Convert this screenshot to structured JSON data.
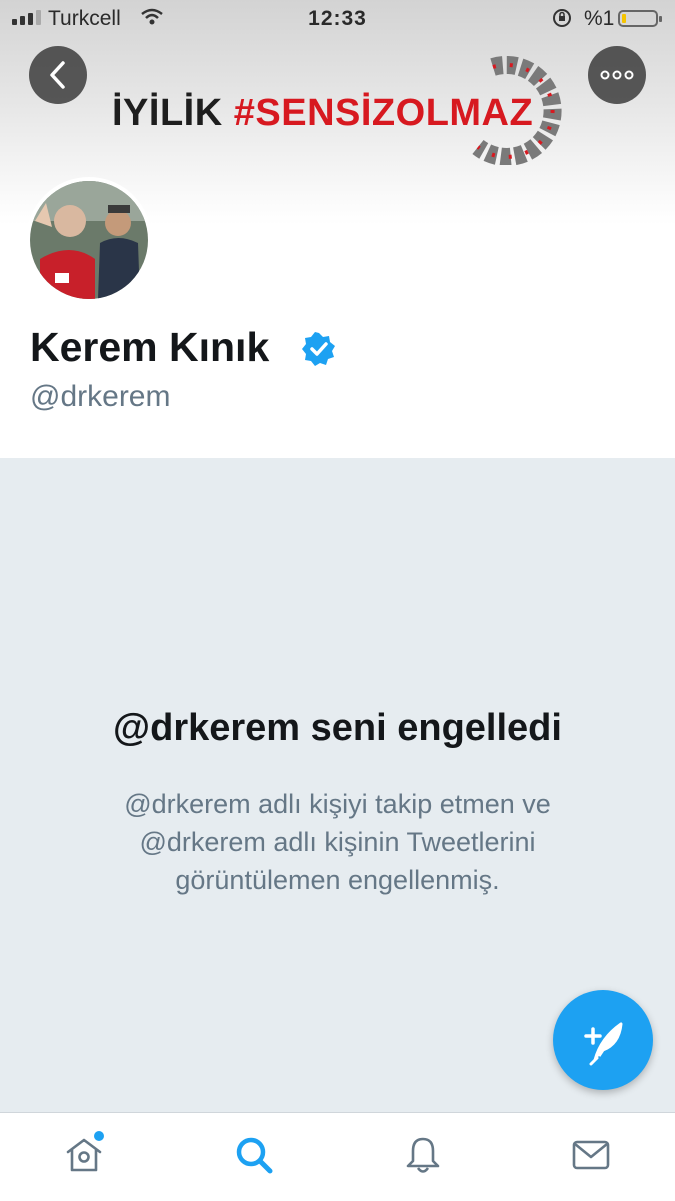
{
  "status_bar": {
    "carrier": "Turkcell",
    "time": "12:33",
    "battery_percent": "%1",
    "battery_level": 0.01
  },
  "header": {
    "banner_text_part1": "İYİLİK",
    "banner_text_part2": "#SENSİZOLMAZ",
    "back_icon": "chevron-left-icon",
    "more_icon": "more-horizontal-icon"
  },
  "profile": {
    "display_name": "Kerem Kınık",
    "handle": "@drkerem",
    "verified": true
  },
  "blocked_notice": {
    "title": "@drkerem seni engelledi",
    "description": "@drkerem adlı kişiyi takip etmen ve @drkerem adlı kişinin Tweetlerini görüntülemen engellenmiş."
  },
  "compose": {
    "icon": "compose-tweet-icon"
  },
  "tab_bar": {
    "tabs": [
      {
        "name": "home",
        "icon": "home-icon",
        "has_notification_dot": true
      },
      {
        "name": "search",
        "icon": "search-icon",
        "active": true
      },
      {
        "name": "notifications",
        "icon": "bell-icon"
      },
      {
        "name": "messages",
        "icon": "mail-icon"
      }
    ]
  },
  "colors": {
    "accent": "#1da1f2",
    "brand_red": "#d71920",
    "secondary_text": "#657786",
    "blocked_bg": "#e6ecf0"
  }
}
